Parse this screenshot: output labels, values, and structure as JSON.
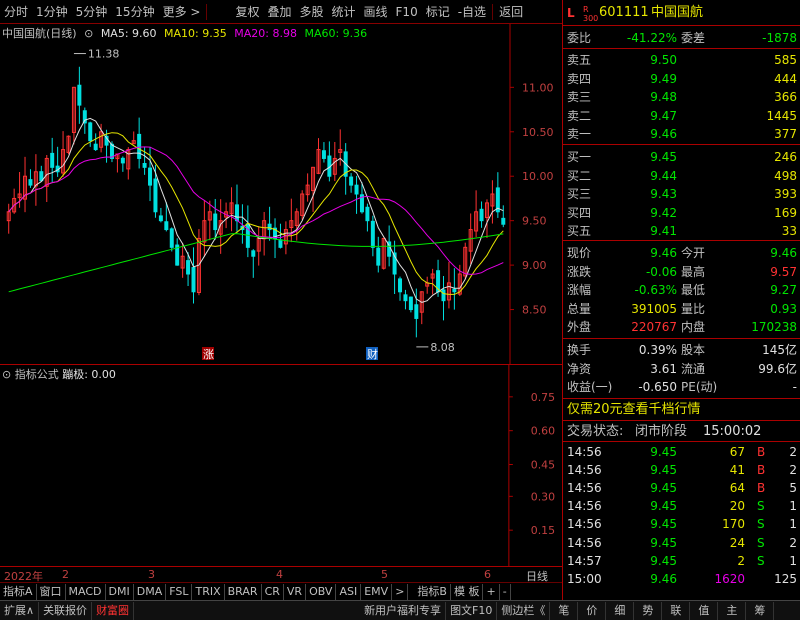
{
  "toolbar": {
    "items": [
      "分时",
      "1分钟",
      "5分钟",
      "15分钟",
      "更多 >",
      "复权",
      "叠加",
      "多股",
      "统计",
      "画线",
      "F10",
      "标记",
      "-自选",
      "返回"
    ]
  },
  "chart": {
    "title": "中国国航(日线)",
    "ma": [
      {
        "label": "MA5: 9.60",
        "color": "#e0e0e0"
      },
      {
        "label": "MA10: 9.35",
        "color": "#e6e600"
      },
      {
        "label": "MA20: 8.98",
        "color": "#e600e6"
      },
      {
        "label": "MA60: 9.36",
        "color": "#00e600"
      }
    ],
    "high_label": "11.38",
    "low_label": "8.08",
    "marker_up": "涨",
    "marker_fin": "财",
    "y_ticks": [
      "11.00",
      "10.50",
      "10.00",
      "9.50",
      "9.00",
      "8.50"
    ]
  },
  "subchart": {
    "header": "指标公式",
    "value": "蹦极: 0.00",
    "y_ticks": [
      "0.75",
      "0.60",
      "0.45",
      "0.30",
      "0.15"
    ]
  },
  "date_axis": {
    "labels": [
      "2022年",
      "2",
      "3",
      "4",
      "5",
      "6"
    ],
    "right": "日线"
  },
  "indicator_tabs": [
    "指标A",
    "窗口",
    "MACD",
    "DMI",
    "DMA",
    "FSL",
    "TRIX",
    "BRAR",
    "CR",
    "VR",
    "OBV",
    "ASI",
    "EMV",
    ">",
    "指标B",
    "模 板",
    "+",
    "-"
  ],
  "bottom_bar": [
    "扩展∧",
    "关联报价",
    "财富圈",
    "新用户福利专享",
    "图文F10",
    "侧边栏《",
    "笔",
    "价",
    "细",
    "势",
    "联",
    "值",
    "主",
    "筹"
  ],
  "quote": {
    "code_prefix": "L",
    "code_sub": "R 300",
    "code": "601111",
    "name": "中国国航",
    "weibi_label": "委比",
    "weibi": "-41.22%",
    "weicha_label": "委差",
    "weicha": "-1878",
    "sells": [
      {
        "label": "卖五",
        "price": "9.50",
        "vol": "585"
      },
      {
        "label": "卖四",
        "price": "9.49",
        "vol": "444"
      },
      {
        "label": "卖三",
        "price": "9.48",
        "vol": "366"
      },
      {
        "label": "卖二",
        "price": "9.47",
        "vol": "1445"
      },
      {
        "label": "卖一",
        "price": "9.46",
        "vol": "377"
      }
    ],
    "buys": [
      {
        "label": "买一",
        "price": "9.45",
        "vol": "246"
      },
      {
        "label": "买二",
        "price": "9.44",
        "vol": "498"
      },
      {
        "label": "买三",
        "price": "9.43",
        "vol": "393"
      },
      {
        "label": "买四",
        "price": "9.42",
        "vol": "169"
      },
      {
        "label": "买五",
        "price": "9.41",
        "vol": "33"
      }
    ],
    "stats": [
      {
        "l1": "现价",
        "v1": "9.46",
        "l2": "今开",
        "v2": "9.46"
      },
      {
        "l1": "涨跌",
        "v1": "-0.06",
        "l2": "最高",
        "v2": "9.57"
      },
      {
        "l1": "涨幅",
        "v1": "-0.63%",
        "l2": "最低",
        "v2": "9.27"
      },
      {
        "l1": "总量",
        "v1": "391005",
        "l2": "量比",
        "v2": "0.93"
      },
      {
        "l1": "外盘",
        "v1": "220767",
        "l2": "内盘",
        "v2": "170238"
      }
    ],
    "stats2": [
      {
        "l1": "换手",
        "v1": "0.39%",
        "l2": "股本",
        "v2": "145亿"
      },
      {
        "l1": "净资",
        "v1": "3.61",
        "l2": "流通",
        "v2": "99.6亿"
      },
      {
        "l1": "收益(一)",
        "v1": "-0.650",
        "l2": "PE(动)",
        "v2": "-"
      }
    ],
    "promo": "仅需20元查看千档行情",
    "status_label": "交易状态:",
    "status": "闭市阶段",
    "status_time": "15:00:02",
    "ticks": [
      {
        "t": "14:56",
        "p": "9.45",
        "v": "67",
        "s": "B",
        "n": "2"
      },
      {
        "t": "14:56",
        "p": "9.45",
        "v": "41",
        "s": "B",
        "n": "2"
      },
      {
        "t": "14:56",
        "p": "9.45",
        "v": "64",
        "s": "B",
        "n": "5"
      },
      {
        "t": "14:56",
        "p": "9.45",
        "v": "20",
        "s": "S",
        "n": "1"
      },
      {
        "t": "14:56",
        "p": "9.45",
        "v": "170",
        "s": "S",
        "n": "1"
      },
      {
        "t": "14:56",
        "p": "9.45",
        "v": "24",
        "s": "S",
        "n": "2"
      },
      {
        "t": "14:57",
        "p": "9.45",
        "v": "2",
        "s": "S",
        "n": "1"
      },
      {
        "t": "15:00",
        "p": "9.46",
        "v": "1620",
        "s": "",
        "n": "125"
      }
    ]
  },
  "colors": {
    "up": "#ff3232",
    "down": "#00e0e0",
    "ma5": "#e0e0e0",
    "ma10": "#e6e600",
    "ma20": "#e600e6",
    "ma60": "#00e600"
  },
  "chart_data": {
    "type": "candlestick",
    "title": "中国国航(日线)",
    "y_range": [
      8.0,
      11.6
    ],
    "period_labels": [
      "2022年",
      "2",
      "3",
      "4",
      "5",
      "6"
    ],
    "annotations": {
      "high": 11.38,
      "low": 8.08
    },
    "closes": [
      9.6,
      9.75,
      9.8,
      10.0,
      9.9,
      10.05,
      9.95,
      10.2,
      10.1,
      10.05,
      10.3,
      10.45,
      11.0,
      10.8,
      10.6,
      10.4,
      10.3,
      10.5,
      10.35,
      10.2,
      10.25,
      10.15,
      10.3,
      10.4,
      10.2,
      10.1,
      9.9,
      9.6,
      9.5,
      9.4,
      9.2,
      9.0,
      9.1,
      8.9,
      8.7,
      9.3,
      9.5,
      9.6,
      9.4,
      9.5,
      9.6,
      9.7,
      9.5,
      9.4,
      9.2,
      9.1,
      9.3,
      9.5,
      9.4,
      9.3,
      9.2,
      9.4,
      9.5,
      9.6,
      9.8,
      9.9,
      10.1,
      10.3,
      10.2,
      10.0,
      10.2,
      10.3,
      10.0,
      9.9,
      9.8,
      9.6,
      9.5,
      9.2,
      9.0,
      9.3,
      9.1,
      8.9,
      8.7,
      8.6,
      8.5,
      8.4,
      8.7,
      8.8,
      8.9,
      8.7,
      8.6,
      8.8,
      8.7,
      8.9,
      9.2,
      9.4,
      9.6,
      9.5,
      9.7,
      9.8,
      9.6,
      9.46
    ],
    "ma5_last": 9.6,
    "ma10_last": 9.35,
    "ma20_last": 8.98,
    "ma60_last": 9.36
  }
}
